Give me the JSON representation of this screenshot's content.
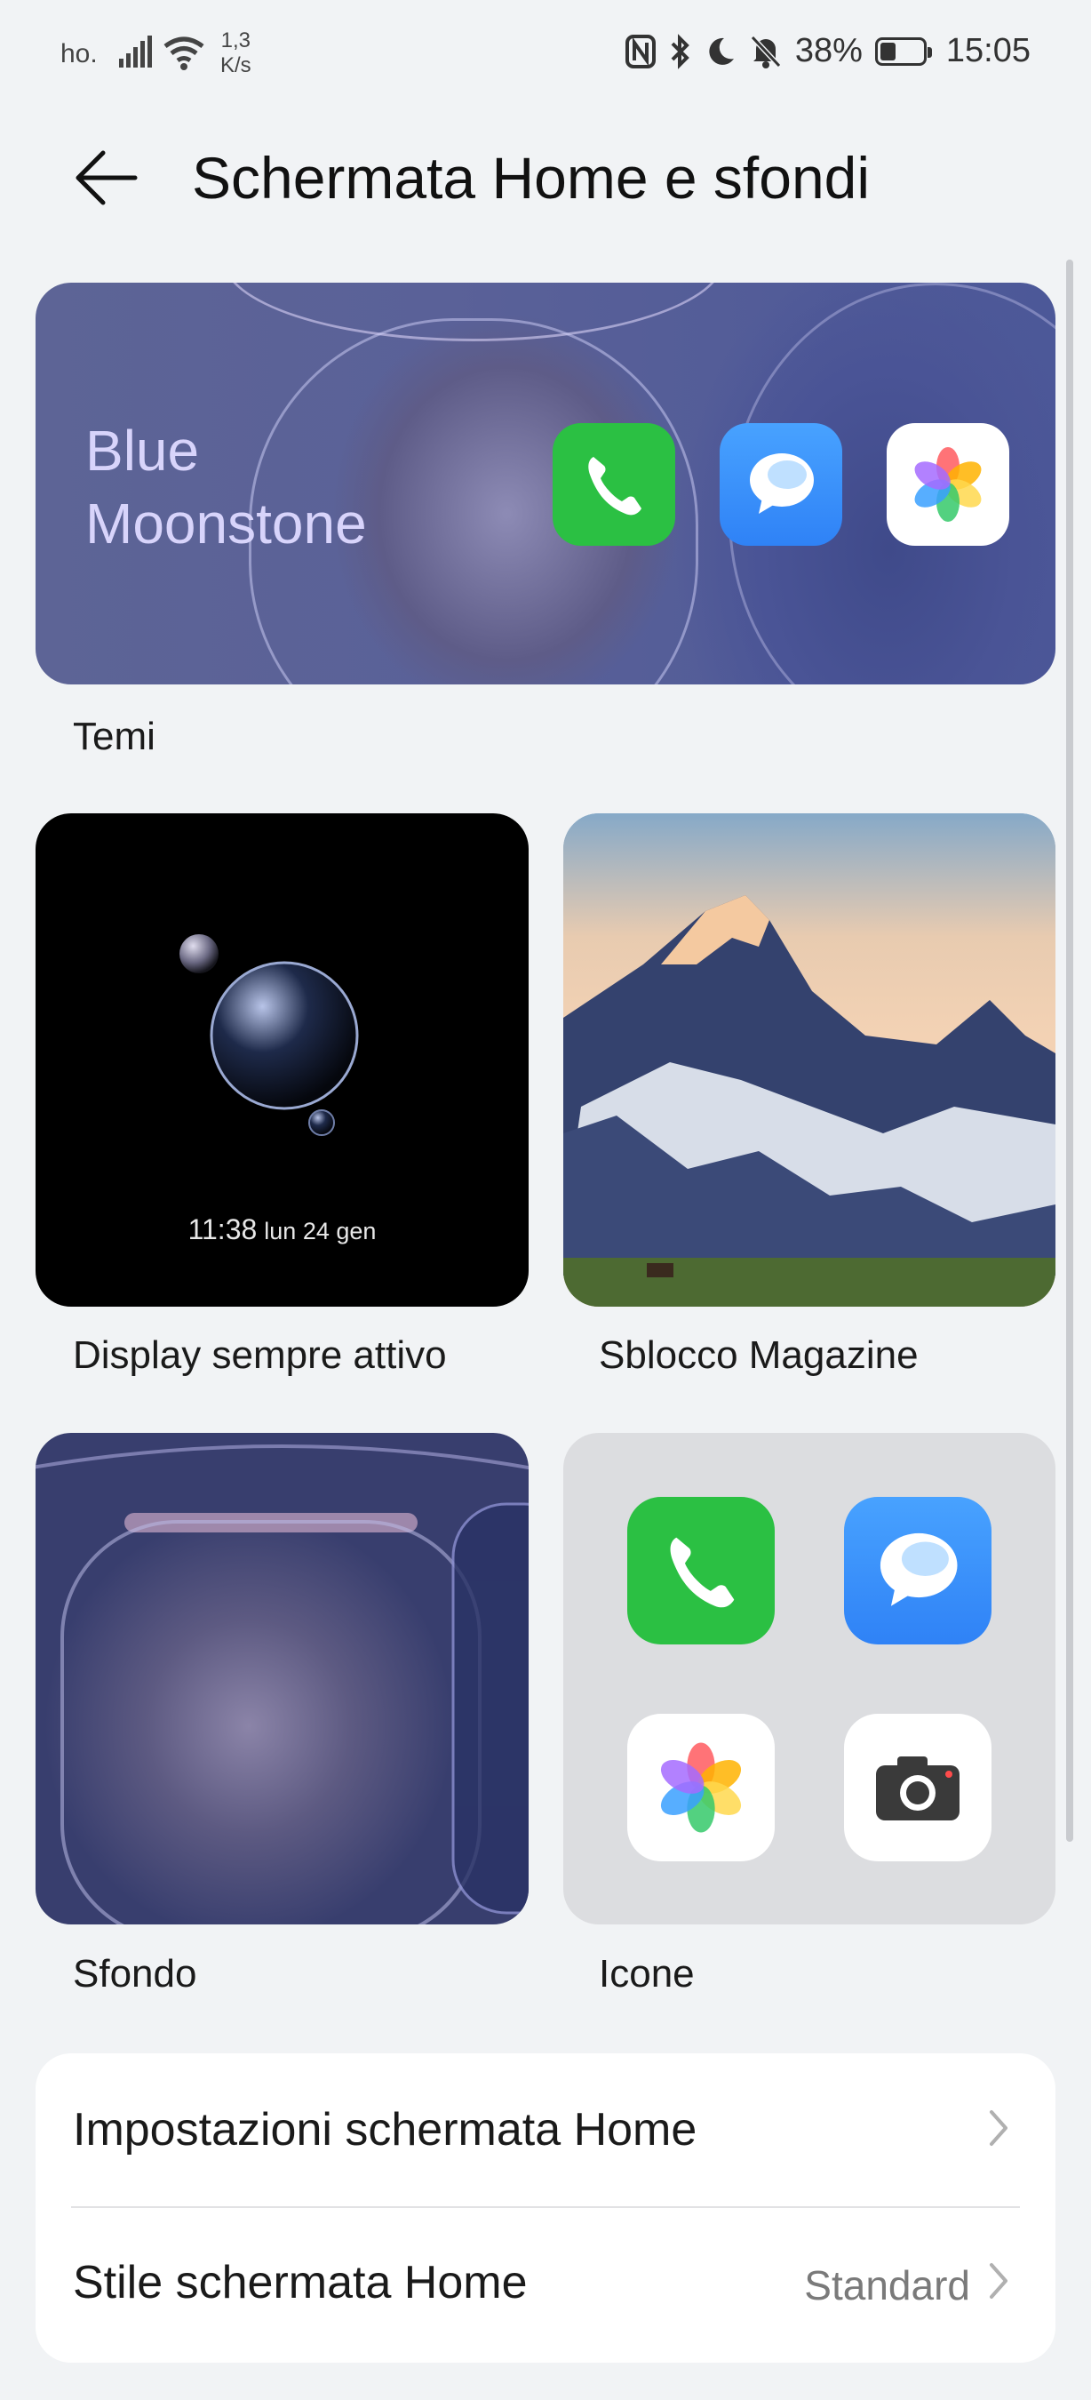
{
  "status_bar": {
    "carrier": "ho.",
    "speed_value": "1,3",
    "speed_unit": "K/s",
    "battery": "38%",
    "battery_level": 0.38,
    "time": "15:05"
  },
  "header": {
    "title": "Schermata Home e sfondi"
  },
  "theme": {
    "name_line1": "Blue",
    "name_line2": "Moonstone",
    "label": "Temi"
  },
  "tiles": {
    "aod_time": "11:38",
    "aod_date": "lun 24 gen",
    "aod_label": "Display sempre attivo",
    "magazine_label": "Sblocco Magazine",
    "wallpaper_label": "Sfondo",
    "icons_label": "Icone"
  },
  "settings": {
    "home_settings": "Impostazioni schermata Home",
    "home_style": "Stile schermata Home",
    "home_style_value": "Standard"
  },
  "colors": {
    "phone_green": "#2bc043",
    "message_blue": "#2f8cff",
    "background": "#f1f3f5"
  }
}
